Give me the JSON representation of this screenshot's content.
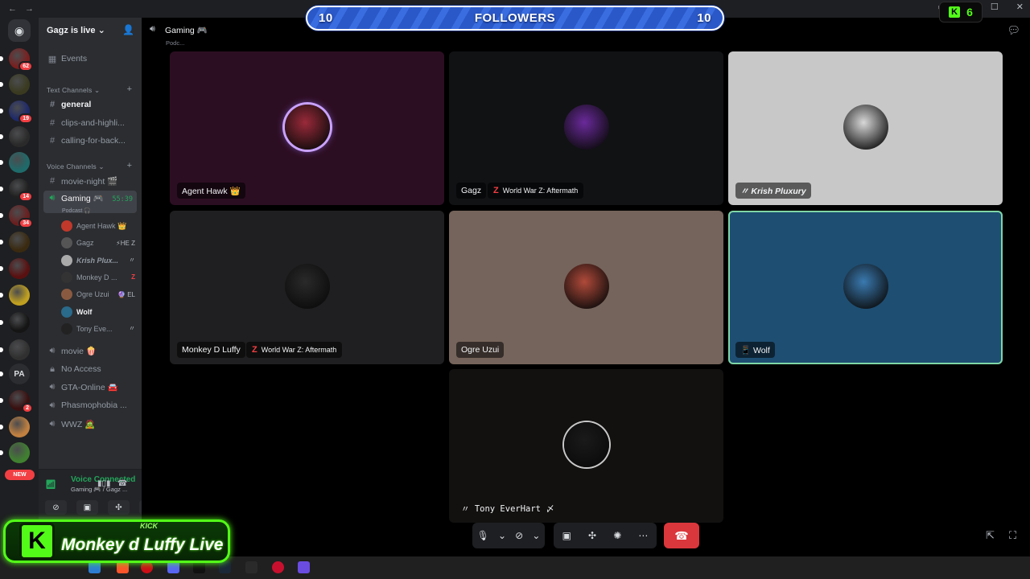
{
  "overlay": {
    "followers_label": "FOLLOWERS",
    "followers_left": "10",
    "followers_right": "10",
    "kick_count": "6",
    "kick_letter": "K",
    "logo_small": "KICK",
    "logo_text": "Monkey d Luffy Live"
  },
  "server": {
    "name": "Gagz is live ⌄",
    "rail": [
      {
        "badge": "62",
        "color": "#7a1f1f"
      },
      {
        "badge": "",
        "color": "#3a3a20"
      },
      {
        "badge": "19",
        "color": "#1f2a6a"
      },
      {
        "badge": "",
        "color": "#2a2a2a"
      },
      {
        "badge": "",
        "color": "#1f6a6a"
      },
      {
        "badge": "14",
        "color": "#202020"
      },
      {
        "badge": "34",
        "color": "#6a1f1f"
      },
      {
        "badge": "",
        "color": "#3a2a10"
      },
      {
        "badge": "",
        "color": "#5a1010"
      },
      {
        "badge": "",
        "color": "#c0a020"
      },
      {
        "badge": "",
        "color": "#151515"
      },
      {
        "badge": "",
        "color": "#303030"
      },
      {
        "badge": "",
        "color": "#2b2d31"
      },
      {
        "badge": "2",
        "color": "#3a1010"
      },
      {
        "badge": "",
        "color": "#c08040"
      },
      {
        "badge": "",
        "color": "#408030"
      }
    ],
    "rail_pa": "PA",
    "new_label": "NEW"
  },
  "sidebar": {
    "events": "Events",
    "text_category": "Text Channels ⌄",
    "text_channels": [
      "general",
      "clips-and-highli...",
      "calling-for-back..."
    ],
    "voice_category": "Voice Channels ⌄",
    "movie_night": "movie-night 🎬",
    "gaming": "Gaming 🎮",
    "gaming_sub": "Podcast 🎧",
    "gaming_time": "55:39",
    "voice_users": [
      {
        "name": "Agent Hawk 👑",
        "extra": ""
      },
      {
        "name": "Gagz",
        "extra": "⚡HE  Z"
      },
      {
        "name": "Krish Plux...",
        "extra": "〃"
      },
      {
        "name": "Monkey D ...",
        "extra": "Z"
      },
      {
        "name": "Ogre Uzui",
        "extra": "🔮 EL"
      },
      {
        "name": "Wolf",
        "extra": ""
      },
      {
        "name": "Tony Eve...",
        "extra": "〃"
      }
    ],
    "other_voice": [
      "movie 🍿",
      "No Access",
      "GTA-Online 🚘",
      "Phasmophobia ...",
      "WWZ 🧟"
    ]
  },
  "voice_panel": {
    "status": "Voice Connected",
    "location": "Gaming 🎮 / Gagz ..."
  },
  "header": {
    "channel": "Gaming 🎮",
    "subtitle": "Podc..."
  },
  "tiles": [
    {
      "name": "Agent Hawk 👑",
      "game": "",
      "bg": "#2c0e22",
      "avatar": "#9a2a3a"
    },
    {
      "name": "Gagz",
      "game": "World War Z: Aftermath",
      "bg": "#111214",
      "avatar": "#6a2a9a"
    },
    {
      "name": "〃 Krish Pluxury",
      "game": "",
      "bg": "#c8c8c8",
      "avatar": "#d8d8d8"
    },
    {
      "name": "Monkey D Luffy",
      "game": "World War Z: Aftermath",
      "bg": "#1f1f21",
      "avatar": "#2a2a2a"
    },
    {
      "name": "Ogre Uzui",
      "game": "",
      "bg": "#75645b",
      "avatar": "#b04a3a"
    },
    {
      "name": "📱 Wolf",
      "game": "",
      "bg": "#1e4e72",
      "avatar": "#3a7ab0"
    },
    {
      "name": "〃 Tony EverHart 〆",
      "game": "",
      "bg": "#121110",
      "avatar": "#1a1a1a"
    }
  ]
}
